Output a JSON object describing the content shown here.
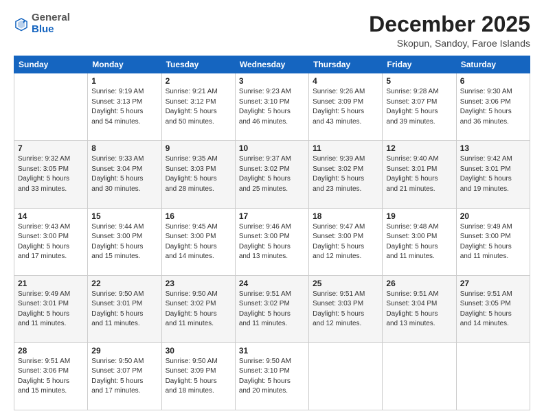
{
  "header": {
    "logo_general": "General",
    "logo_blue": "Blue",
    "month_title": "December 2025",
    "location": "Skopun, Sandoy, Faroe Islands"
  },
  "weekdays": [
    "Sunday",
    "Monday",
    "Tuesday",
    "Wednesday",
    "Thursday",
    "Friday",
    "Saturday"
  ],
  "weeks": [
    [
      {
        "day": "",
        "info": ""
      },
      {
        "day": "1",
        "info": "Sunrise: 9:19 AM\nSunset: 3:13 PM\nDaylight: 5 hours\nand 54 minutes."
      },
      {
        "day": "2",
        "info": "Sunrise: 9:21 AM\nSunset: 3:12 PM\nDaylight: 5 hours\nand 50 minutes."
      },
      {
        "day": "3",
        "info": "Sunrise: 9:23 AM\nSunset: 3:10 PM\nDaylight: 5 hours\nand 46 minutes."
      },
      {
        "day": "4",
        "info": "Sunrise: 9:26 AM\nSunset: 3:09 PM\nDaylight: 5 hours\nand 43 minutes."
      },
      {
        "day": "5",
        "info": "Sunrise: 9:28 AM\nSunset: 3:07 PM\nDaylight: 5 hours\nand 39 minutes."
      },
      {
        "day": "6",
        "info": "Sunrise: 9:30 AM\nSunset: 3:06 PM\nDaylight: 5 hours\nand 36 minutes."
      }
    ],
    [
      {
        "day": "7",
        "info": "Sunrise: 9:32 AM\nSunset: 3:05 PM\nDaylight: 5 hours\nand 33 minutes."
      },
      {
        "day": "8",
        "info": "Sunrise: 9:33 AM\nSunset: 3:04 PM\nDaylight: 5 hours\nand 30 minutes."
      },
      {
        "day": "9",
        "info": "Sunrise: 9:35 AM\nSunset: 3:03 PM\nDaylight: 5 hours\nand 28 minutes."
      },
      {
        "day": "10",
        "info": "Sunrise: 9:37 AM\nSunset: 3:02 PM\nDaylight: 5 hours\nand 25 minutes."
      },
      {
        "day": "11",
        "info": "Sunrise: 9:39 AM\nSunset: 3:02 PM\nDaylight: 5 hours\nand 23 minutes."
      },
      {
        "day": "12",
        "info": "Sunrise: 9:40 AM\nSunset: 3:01 PM\nDaylight: 5 hours\nand 21 minutes."
      },
      {
        "day": "13",
        "info": "Sunrise: 9:42 AM\nSunset: 3:01 PM\nDaylight: 5 hours\nand 19 minutes."
      }
    ],
    [
      {
        "day": "14",
        "info": "Sunrise: 9:43 AM\nSunset: 3:00 PM\nDaylight: 5 hours\nand 17 minutes."
      },
      {
        "day": "15",
        "info": "Sunrise: 9:44 AM\nSunset: 3:00 PM\nDaylight: 5 hours\nand 15 minutes."
      },
      {
        "day": "16",
        "info": "Sunrise: 9:45 AM\nSunset: 3:00 PM\nDaylight: 5 hours\nand 14 minutes."
      },
      {
        "day": "17",
        "info": "Sunrise: 9:46 AM\nSunset: 3:00 PM\nDaylight: 5 hours\nand 13 minutes."
      },
      {
        "day": "18",
        "info": "Sunrise: 9:47 AM\nSunset: 3:00 PM\nDaylight: 5 hours\nand 12 minutes."
      },
      {
        "day": "19",
        "info": "Sunrise: 9:48 AM\nSunset: 3:00 PM\nDaylight: 5 hours\nand 11 minutes."
      },
      {
        "day": "20",
        "info": "Sunrise: 9:49 AM\nSunset: 3:00 PM\nDaylight: 5 hours\nand 11 minutes."
      }
    ],
    [
      {
        "day": "21",
        "info": "Sunrise: 9:49 AM\nSunset: 3:01 PM\nDaylight: 5 hours\nand 11 minutes."
      },
      {
        "day": "22",
        "info": "Sunrise: 9:50 AM\nSunset: 3:01 PM\nDaylight: 5 hours\nand 11 minutes."
      },
      {
        "day": "23",
        "info": "Sunrise: 9:50 AM\nSunset: 3:02 PM\nDaylight: 5 hours\nand 11 minutes."
      },
      {
        "day": "24",
        "info": "Sunrise: 9:51 AM\nSunset: 3:02 PM\nDaylight: 5 hours\nand 11 minutes."
      },
      {
        "day": "25",
        "info": "Sunrise: 9:51 AM\nSunset: 3:03 PM\nDaylight: 5 hours\nand 12 minutes."
      },
      {
        "day": "26",
        "info": "Sunrise: 9:51 AM\nSunset: 3:04 PM\nDaylight: 5 hours\nand 13 minutes."
      },
      {
        "day": "27",
        "info": "Sunrise: 9:51 AM\nSunset: 3:05 PM\nDaylight: 5 hours\nand 14 minutes."
      }
    ],
    [
      {
        "day": "28",
        "info": "Sunrise: 9:51 AM\nSunset: 3:06 PM\nDaylight: 5 hours\nand 15 minutes."
      },
      {
        "day": "29",
        "info": "Sunrise: 9:50 AM\nSunset: 3:07 PM\nDaylight: 5 hours\nand 17 minutes."
      },
      {
        "day": "30",
        "info": "Sunrise: 9:50 AM\nSunset: 3:09 PM\nDaylight: 5 hours\nand 18 minutes."
      },
      {
        "day": "31",
        "info": "Sunrise: 9:50 AM\nSunset: 3:10 PM\nDaylight: 5 hours\nand 20 minutes."
      },
      {
        "day": "",
        "info": ""
      },
      {
        "day": "",
        "info": ""
      },
      {
        "day": "",
        "info": ""
      }
    ]
  ]
}
